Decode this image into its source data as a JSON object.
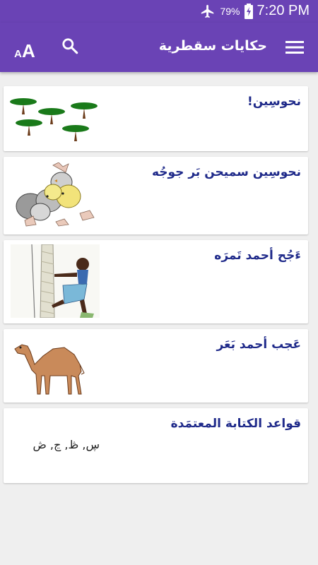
{
  "status_bar": {
    "battery_percent": "79%",
    "time": "7:20 PM",
    "icons": [
      "airplane-mode-icon",
      "battery-charging-icon"
    ]
  },
  "app_bar": {
    "title": "حكايات سقطرية",
    "font_button_label": "AA",
    "icons": [
      "font-size-icon",
      "search-icon",
      "menu-icon"
    ],
    "color": "#6a43b5"
  },
  "stories": [
    {
      "title": "نحوسِين!",
      "image": "trees-illustration"
    },
    {
      "title": "نحوسِين سميحن بَر جوجُه",
      "image": "chicks-illustration"
    },
    {
      "title": "ءَجُح أحمد تَمرَه",
      "image": "boy-climbing-palm-illustration"
    },
    {
      "title": "عَجب أحمد بَعَر",
      "image": "camel-illustration"
    },
    {
      "title": "قواعد الكتابة المعتمَدة",
      "subtitle": "ڛ, ڟ, ڃ, ڞ"
    }
  ]
}
